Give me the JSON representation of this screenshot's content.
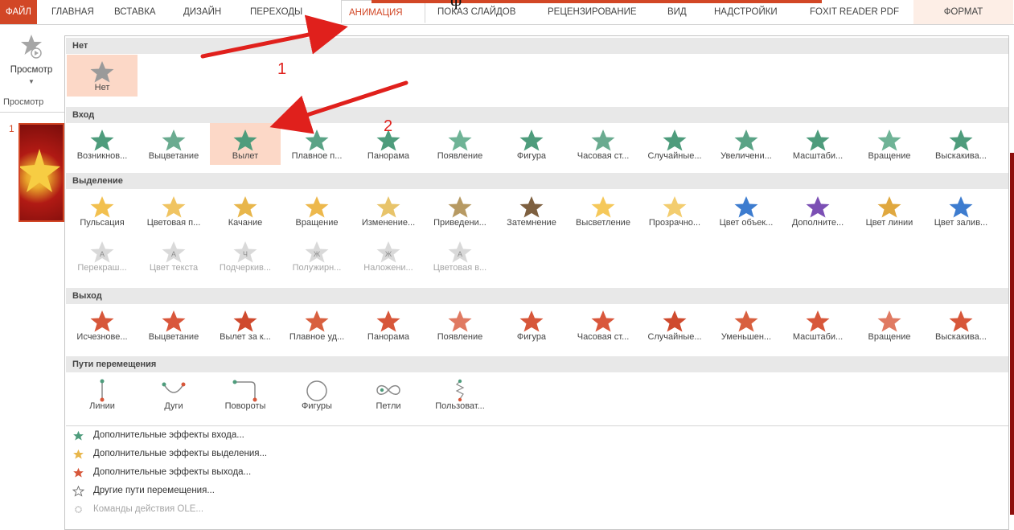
{
  "ribbon": {
    "tabs": [
      "ФАЙЛ",
      "ГЛАВНАЯ",
      "ВСТАВКА",
      "ДИЗАЙН",
      "ПЕРЕХОДЫ",
      "АНИМАЦИЯ",
      "ПОКАЗ СЛАЙДОВ",
      "РЕЦЕНЗИРОВАНИЕ",
      "ВИД",
      "НАДСТРОЙКИ",
      "FOXIT READER PDF",
      "ФОРМАТ"
    ],
    "active_tab": "АНИМАЦИЯ",
    "top_text": "ф",
    "preview_label": "Просмотр",
    "preview_group": "Просмотр"
  },
  "slides": {
    "number": "1"
  },
  "gallery": {
    "none": {
      "title": "Нет",
      "items": [
        "Нет"
      ]
    },
    "entrance": {
      "title": "Вход",
      "items": [
        "Возникнов...",
        "Выцветание",
        "Вылет",
        "Плавное п...",
        "Панорама",
        "Появление",
        "Фигура",
        "Часовая ст...",
        "Случайные...",
        "Увеличени...",
        "Масштаби...",
        "Вращение",
        "Выскакива..."
      ],
      "selected": "Вылет"
    },
    "emphasis": {
      "title": "Выделение",
      "items": [
        "Пульсация",
        "Цветовая п...",
        "Качание",
        "Вращение",
        "Изменение...",
        "Приведени...",
        "Затемнение",
        "Высветление",
        "Прозрачно...",
        "Цвет объек...",
        "Дополните...",
        "Цвет линии",
        "Цвет залив..."
      ],
      "items2": [
        "Перекраш...",
        "Цвет текста",
        "Подчеркив...",
        "Полужирн...",
        "Наложени...",
        "Цветовая в..."
      ],
      "items2_letters": [
        "A",
        "A",
        "Ч",
        "Ж",
        "Ж",
        "A"
      ]
    },
    "exit": {
      "title": "Выход",
      "items": [
        "Исчезнове...",
        "Выцветание",
        "Вылет за к...",
        "Плавное уд...",
        "Панорама",
        "Появление",
        "Фигура",
        "Часовая ст...",
        "Случайные...",
        "Уменьшен...",
        "Масштаби...",
        "Вращение",
        "Выскакива..."
      ]
    },
    "paths": {
      "title": "Пути перемещения",
      "items": [
        "Линии",
        "Дуги",
        "Повороты",
        "Фигуры",
        "Петли",
        "Пользоват..."
      ]
    }
  },
  "more_effects": [
    {
      "label": "Дополнительные эффекты входа...",
      "icon": "green-star-icon"
    },
    {
      "label": "Дополнительные эффекты выделения...",
      "icon": "gold-star-icon"
    },
    {
      "label": "Дополнительные эффекты выхода...",
      "icon": "red-star-icon"
    },
    {
      "label": "Другие пути перемещения...",
      "icon": "outline-star-icon"
    },
    {
      "label": "Команды действия OLE...",
      "icon": "ole-gear-icon",
      "disabled": true
    }
  ],
  "annotations": {
    "step1": "1",
    "step2": "2"
  },
  "colors": {
    "accent": "#d24726",
    "entrance": "#4e9c7c",
    "emphasis": "#e8b64b",
    "exit": "#d7573a",
    "selected_bg": "#fcd8c7",
    "arrow": "#e0201c"
  }
}
